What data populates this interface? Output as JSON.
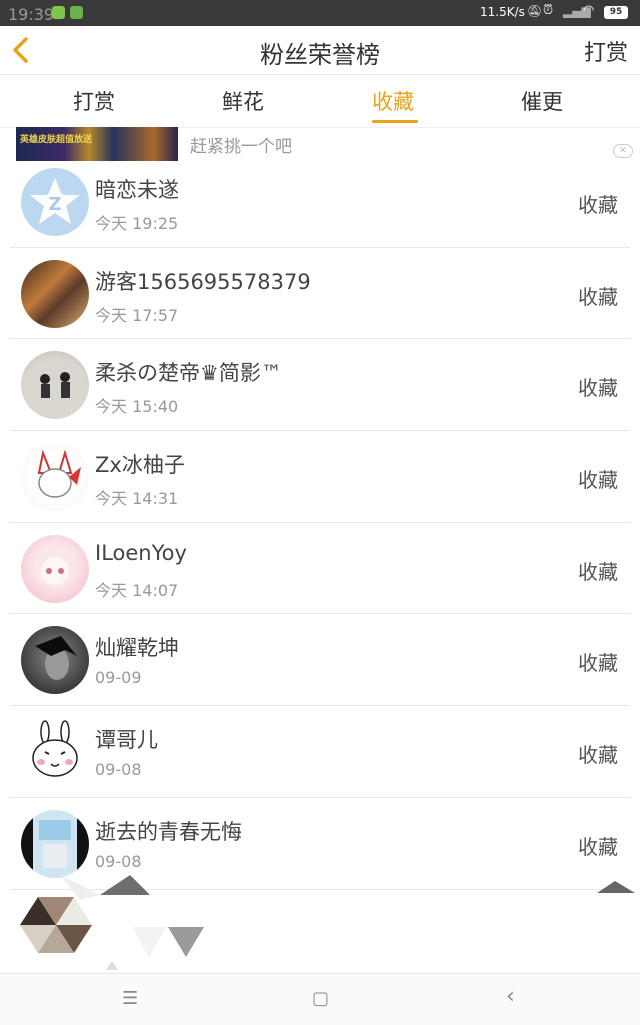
{
  "status_bar": {
    "time": "19:39",
    "net_speed": "11.5K/s",
    "battery": "95",
    "icons": [
      "app-icon-green",
      "app-icon-leaf",
      "mute-icon",
      "alarm-icon",
      "signal-icon",
      "wifi-icon",
      "battery-icon"
    ]
  },
  "header": {
    "title": "粉丝荣誉榜",
    "right_action": "打赏",
    "back_icon": "chevron-left-icon",
    "accent": "#e8a318"
  },
  "tabs": [
    {
      "label": "打赏",
      "active": false
    },
    {
      "label": "鲜花",
      "active": false
    },
    {
      "label": "收藏",
      "active": true
    },
    {
      "label": "催更",
      "active": false
    }
  ],
  "ad": {
    "banner_text": "英雄皮肤超值放送",
    "text": "赶紧挑一个吧",
    "close_icon": "close-icon"
  },
  "list": [
    {
      "name": "暗恋未遂",
      "time": "今天 19:25",
      "action": "收藏"
    },
    {
      "name": "游客1565695578379",
      "time": "今天 17:57",
      "action": "收藏"
    },
    {
      "name": "柔杀の楚帝♛简影™",
      "time": "今天 15:40",
      "action": "收藏"
    },
    {
      "name": "Zx冰柚子",
      "time": "今天 14:31",
      "action": "收藏"
    },
    {
      "name": "ILoenYoy",
      "time": "今天 14:07",
      "action": "收藏"
    },
    {
      "name": "灿耀乾坤",
      "time": "09-09",
      "action": "收藏"
    },
    {
      "name": "谭哥儿",
      "time": "09-08",
      "action": "收藏"
    },
    {
      "name": "逝去的青春无悔",
      "time": "09-08",
      "action": "收藏"
    }
  ],
  "nav_bar": {
    "menu": "☰",
    "home": "▢",
    "back": "‹"
  }
}
